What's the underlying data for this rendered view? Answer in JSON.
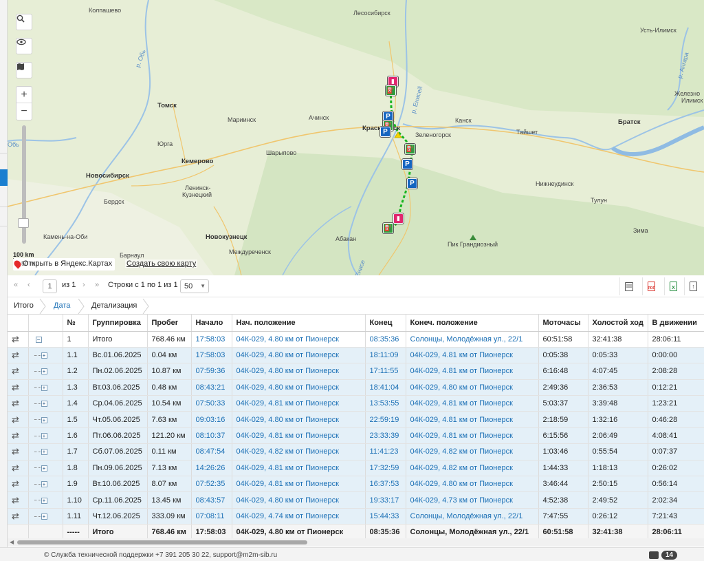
{
  "map": {
    "cities": [
      {
        "name": "Колпашево",
        "bold": false
      },
      {
        "name": "Лесосибирск",
        "bold": false
      },
      {
        "name": "Усть-Илимск",
        "bold": false
      },
      {
        "name": "Железно",
        "bold": false
      },
      {
        "name": "Илимск",
        "bold": false
      },
      {
        "name": "Томск",
        "bold": true
      },
      {
        "name": "Мариинск",
        "bold": false
      },
      {
        "name": "Ачинск",
        "bold": false
      },
      {
        "name": "Красноярск",
        "bold": true
      },
      {
        "name": "Зеленогорск",
        "bold": false
      },
      {
        "name": "Канск",
        "bold": false
      },
      {
        "name": "Тайшет",
        "bold": false
      },
      {
        "name": "Братск",
        "bold": true
      },
      {
        "name": "Юрга",
        "bold": false
      },
      {
        "name": "Кемерово",
        "bold": true
      },
      {
        "name": "Шарыпово",
        "bold": false
      },
      {
        "name": "Новосибирск",
        "bold": true
      },
      {
        "name": "Ленинск-",
        "bold": false
      },
      {
        "name": "Кузнецкий",
        "bold": false
      },
      {
        "name": "Бердск",
        "bold": false
      },
      {
        "name": "Нижнеудинск",
        "bold": false
      },
      {
        "name": "Тулун",
        "bold": false
      },
      {
        "name": "Камень-на-Оби",
        "bold": false
      },
      {
        "name": "Новокузнецк",
        "bold": true
      },
      {
        "name": "Абакан",
        "bold": false
      },
      {
        "name": "Зима",
        "bold": false
      },
      {
        "name": "Барнаул",
        "bold": false
      },
      {
        "name": "Междуреченск",
        "bold": false
      },
      {
        "name": "Пик Грандиозный",
        "bold": false
      }
    ],
    "rivers": [
      "р. Обь",
      "р. Енисей",
      "р. Ангара",
      "Обь",
      "Енисе"
    ],
    "scale_label": "100 km",
    "scale_label2": "50 mi",
    "yandex_link": "Открыть в Яндекс.Картах",
    "create_map": "Создать свою карту",
    "markers": [
      {
        "type": "r",
        "glyph": "▮"
      },
      {
        "type": "f",
        "glyph": "⛽"
      },
      {
        "type": "p",
        "glyph": "P"
      },
      {
        "type": "f",
        "glyph": "⛽"
      },
      {
        "type": "p",
        "glyph": "P"
      },
      {
        "type": "f",
        "glyph": "⛽"
      },
      {
        "type": "p",
        "glyph": "P"
      },
      {
        "type": "p",
        "glyph": "P"
      },
      {
        "type": "r",
        "glyph": "▮"
      },
      {
        "type": "f",
        "glyph": "⛽"
      }
    ],
    "icons": [
      "search-icon",
      "eye-icon",
      "map-layers-icon",
      "zoom-in-icon",
      "zoom-out-icon"
    ],
    "zoom_in": "+",
    "zoom_out": "−"
  },
  "toolbar": {
    "page": "1",
    "of": "из 1",
    "rows_text": "Строки с 1 по 1 из 1",
    "rows_per_page": "50",
    "buttons": [
      {
        "name": "columns-icon",
        "glyph": "",
        "color": "#555555"
      },
      {
        "name": "pdf-icon",
        "glyph": "PDF",
        "color": "#d9322b"
      },
      {
        "name": "excel-icon",
        "glyph": "X",
        "color": "#1f8a3a"
      },
      {
        "name": "export-icon",
        "glyph": "↑",
        "color": "#555555"
      }
    ]
  },
  "crumbs": [
    "Итого",
    "Дата",
    "Детализация"
  ],
  "table": {
    "headers": [
      "№",
      "Группировка",
      "Пробег",
      "Начало",
      "Нач. положение",
      "Конец",
      "Конеч. положение",
      "Моточасы",
      "Холостой ход",
      "В движении"
    ],
    "rows": [
      {
        "kind": "top",
        "no": "1",
        "group": "Итого",
        "mileage": "768.46 км",
        "start": "17:58:03",
        "start_pos": "04К-029, 4.80 км от Пионерск",
        "end": "08:35:36",
        "end_pos": "Солонцы, Молодёжная ул., 22/1",
        "engine": "60:51:58",
        "idle": "32:41:38",
        "moving": "28:06:11"
      },
      {
        "kind": "sub",
        "no": "1.1",
        "group": "Вс.01.06.2025",
        "mileage": "0.04 км",
        "start": "17:58:03",
        "start_pos": "04К-029, 4.80 км от Пионерск",
        "end": "18:11:09",
        "end_pos": "04К-029, 4.81 км от Пионерск",
        "engine": "0:05:38",
        "idle": "0:05:33",
        "moving": "0:00:00"
      },
      {
        "kind": "sub",
        "no": "1.2",
        "group": "Пн.02.06.2025",
        "mileage": "10.87 км",
        "start": "07:59:36",
        "start_pos": "04К-029, 4.80 км от Пионерск",
        "end": "17:11:55",
        "end_pos": "04К-029, 4.81 км от Пионерск",
        "engine": "6:16:48",
        "idle": "4:07:45",
        "moving": "2:08:28"
      },
      {
        "kind": "sub",
        "no": "1.3",
        "group": "Вт.03.06.2025",
        "mileage": "0.48 км",
        "start": "08:43:21",
        "start_pos": "04К-029, 4.80 км от Пионерск",
        "end": "18:41:04",
        "end_pos": "04К-029, 4.80 км от Пионерск",
        "engine": "2:49:36",
        "idle": "2:36:53",
        "moving": "0:12:21"
      },
      {
        "kind": "sub",
        "no": "1.4",
        "group": "Ср.04.06.2025",
        "mileage": "10.54 км",
        "start": "07:50:33",
        "start_pos": "04К-029, 4.81 км от Пионерск",
        "end": "13:53:55",
        "end_pos": "04К-029, 4.81 км от Пионерск",
        "engine": "5:03:37",
        "idle": "3:39:48",
        "moving": "1:23:21"
      },
      {
        "kind": "sub",
        "no": "1.5",
        "group": "Чт.05.06.2025",
        "mileage": "7.63 км",
        "start": "09:03:16",
        "start_pos": "04К-029, 4.80 км от Пионерск",
        "end": "22:59:19",
        "end_pos": "04К-029, 4.81 км от Пионерск",
        "engine": "2:18:59",
        "idle": "1:32:16",
        "moving": "0:46:28"
      },
      {
        "kind": "sub",
        "no": "1.6",
        "group": "Пт.06.06.2025",
        "mileage": "121.20 км",
        "start": "08:10:37",
        "start_pos": "04К-029, 4.81 км от Пионерск",
        "end": "23:33:39",
        "end_pos": "04К-029, 4.81 км от Пионерск",
        "engine": "6:15:56",
        "idle": "2:06:49",
        "moving": "4:08:41"
      },
      {
        "kind": "sub",
        "no": "1.7",
        "group": "Сб.07.06.2025",
        "mileage": "0.11 км",
        "start": "08:47:54",
        "start_pos": "04К-029, 4.82 км от Пионерск",
        "end": "11:41:23",
        "end_pos": "04К-029, 4.82 км от Пионерск",
        "engine": "1:03:46",
        "idle": "0:55:54",
        "moving": "0:07:37"
      },
      {
        "kind": "sub",
        "no": "1.8",
        "group": "Пн.09.06.2025",
        "mileage": "7.13 км",
        "start": "14:26:26",
        "start_pos": "04К-029, 4.81 км от Пионерск",
        "end": "17:32:59",
        "end_pos": "04К-029, 4.82 км от Пионерск",
        "engine": "1:44:33",
        "idle": "1:18:13",
        "moving": "0:26:02"
      },
      {
        "kind": "sub",
        "no": "1.9",
        "group": "Вт.10.06.2025",
        "mileage": "8.07 км",
        "start": "07:52:35",
        "start_pos": "04К-029, 4.81 км от Пионерск",
        "end": "16:37:53",
        "end_pos": "04К-029, 4.80 км от Пионерск",
        "engine": "3:46:44",
        "idle": "2:50:15",
        "moving": "0:56:14"
      },
      {
        "kind": "sub",
        "no": "1.10",
        "group": "Ср.11.06.2025",
        "mileage": "13.45 км",
        "start": "08:43:57",
        "start_pos": "04К-029, 4.80 км от Пионерск",
        "end": "19:33:17",
        "end_pos": "04К-029, 4.73 км от Пионерск",
        "engine": "4:52:38",
        "idle": "2:49:52",
        "moving": "2:02:34"
      },
      {
        "kind": "sub",
        "no": "1.11",
        "group": "Чт.12.06.2025",
        "mileage": "333.09 км",
        "start": "07:08:11",
        "start_pos": "04К-029, 4.74 км от Пионерск",
        "end": "15:44:33",
        "end_pos": "Солонцы, Молодёжная ул., 22/1",
        "engine": "7:47:55",
        "idle": "0:26:12",
        "moving": "7:21:43"
      }
    ],
    "total": {
      "no": "-----",
      "group": "Итого",
      "mileage": "768.46 км",
      "start": "17:58:03",
      "start_pos": "04К-029, 4.80 км от Пионерск",
      "end": "08:35:36",
      "end_pos": "Солонцы, Молодёжная ул., 22/1",
      "engine": "60:51:58",
      "idle": "32:41:38",
      "moving": "28:06:11"
    }
  },
  "footer": {
    "support": "© Служба технической поддержки +7 391 205 30 22, support@m2m-sib.ru",
    "count": "14"
  }
}
